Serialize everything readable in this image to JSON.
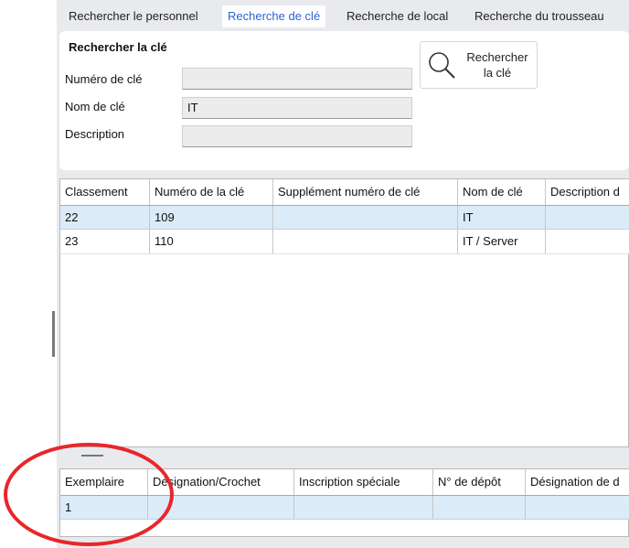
{
  "tabs": [
    {
      "label": "Rechercher le personnel"
    },
    {
      "label": "Recherche de clé"
    },
    {
      "label": "Recherche de local"
    },
    {
      "label": "Recherche du trousseau"
    }
  ],
  "search_panel": {
    "title": "Rechercher la clé",
    "fields": [
      {
        "label": "Numéro de clé",
        "value": ""
      },
      {
        "label": "Nom de clé",
        "value": "IT"
      },
      {
        "label": "Description",
        "value": ""
      }
    ],
    "button_label": "Rechercher\nla clé",
    "button_icon": "magnifier-icon"
  },
  "keys_table": {
    "columns": [
      "Classement",
      "Numéro de la clé",
      "Supplément numéro de clé",
      "Nom de clé",
      "Description d"
    ],
    "rows": [
      {
        "cells": [
          "22",
          "109",
          "",
          "IT",
          ""
        ],
        "selected": true
      },
      {
        "cells": [
          "23",
          "110",
          "",
          "IT / Server",
          ""
        ],
        "selected": false
      }
    ]
  },
  "copies_table": {
    "columns": [
      "Exemplaire",
      "Désignation/Crochet",
      "Inscription spéciale",
      "N° de dépôt",
      "Désignation de d"
    ],
    "rows": [
      {
        "cells": [
          "1",
          "",
          "",
          "",
          ""
        ],
        "selected": true
      }
    ]
  },
  "colors": {
    "accent_tab": "#2a63d4",
    "selected_row": "#dcebf8",
    "annotation": "#e8262a"
  }
}
